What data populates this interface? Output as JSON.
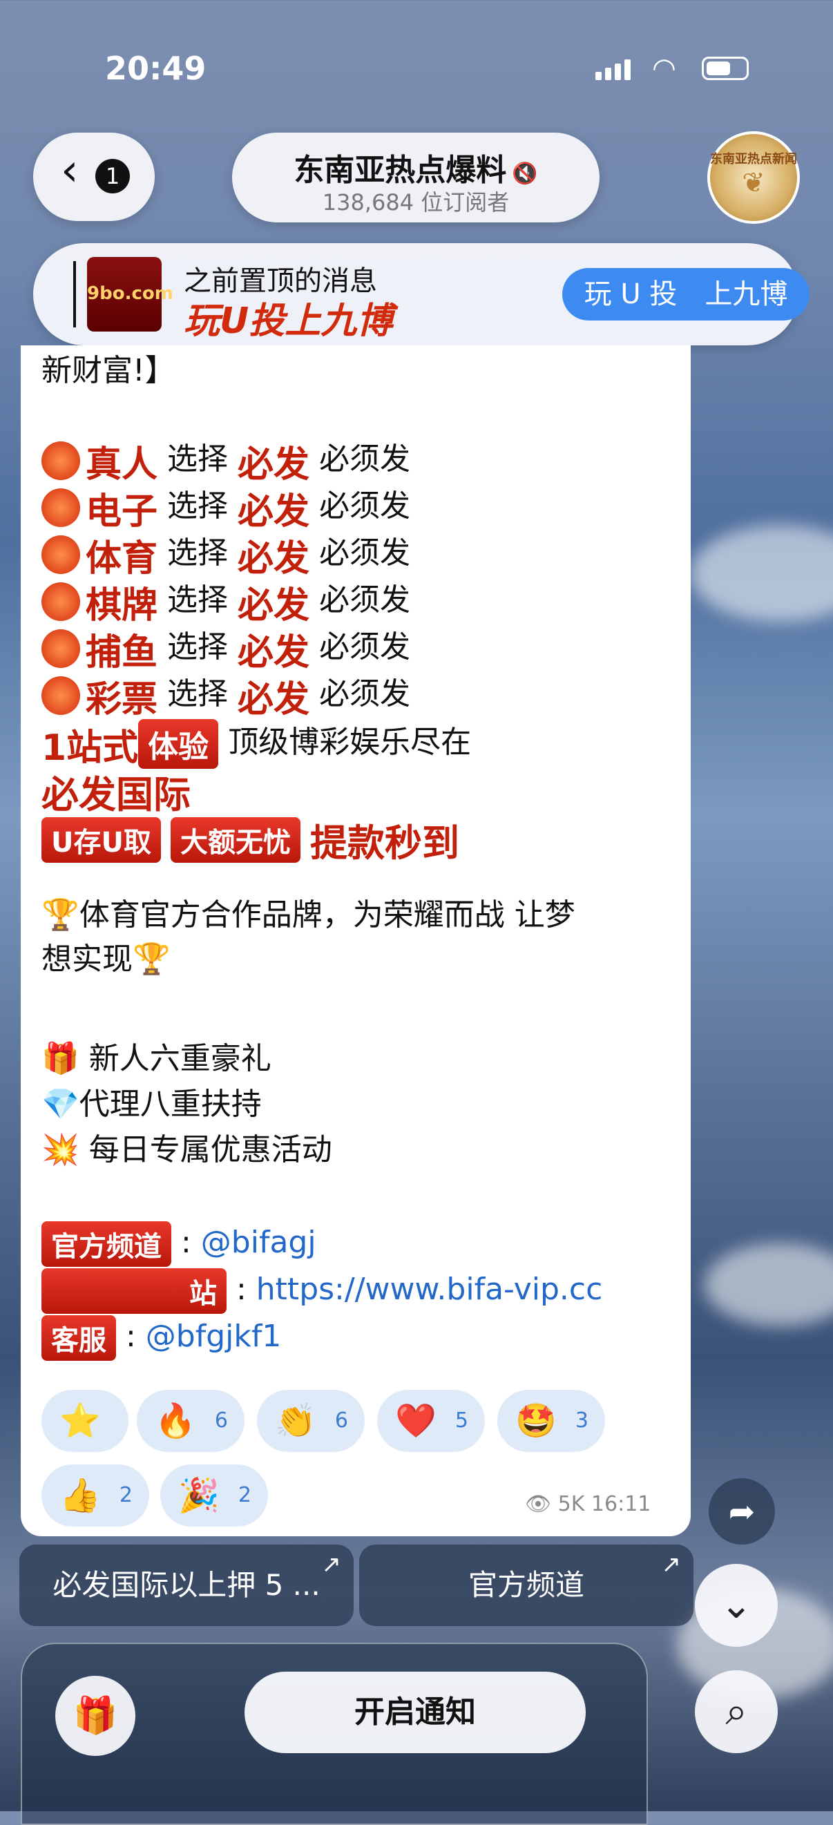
{
  "status": {
    "time": "20:49"
  },
  "header": {
    "back_count": "1",
    "title": "东南亚热点爆料",
    "subscribers": "138,684 位订阅者",
    "avatar_text": "东南亚热点新闻"
  },
  "pinned": {
    "label": "之前置顶的消息",
    "text": "玩U投上九博",
    "thumb_text": "9bo.com",
    "button": "玩 U 投　上九博"
  },
  "message": {
    "lead": "新财富!】",
    "rows": [
      {
        "tag": "真人",
        "text": "选择",
        "brand": "必发",
        "tail": "必须发"
      },
      {
        "tag": "电子",
        "text": "选择",
        "brand": "必发",
        "tail": "必须发"
      },
      {
        "tag": "体育",
        "text": "选择",
        "brand": "必发",
        "tail": "必须发"
      },
      {
        "tag": "棋牌",
        "text": "选择",
        "brand": "必发",
        "tail": "必须发"
      },
      {
        "tag": "捕鱼",
        "text": "选择",
        "brand": "必发",
        "tail": "必须发"
      },
      {
        "tag": "彩票",
        "text": "选择",
        "brand": "必发",
        "tail": "必须发"
      }
    ],
    "onestop_a": "1站式",
    "onestop_b": "体验",
    "onestop_text": "顶级博彩娱乐尽在",
    "brand_big": "必发国际",
    "u_badge": "U存U取",
    "big_badge": "大额无忧",
    "fast": "提款秒到",
    "trophy_line1": "🏆体育官方合作品牌，为荣耀而战  让梦",
    "trophy_line2": "想实现🏆",
    "gift": "🎁 新人六重豪礼",
    "diamond": "💎代理八重扶持",
    "spark": "💥 每日专属优惠活动",
    "official_label": "官方频道",
    "official_value": "@bifagj",
    "site_label": "站",
    "site_value": "https://www.bifa-vip.cc",
    "service_label": "客服",
    "service_value": "@bfgjkf1"
  },
  "reactions": [
    {
      "emoji": "⭐",
      "count": ""
    },
    {
      "emoji": "🔥",
      "count": "6"
    },
    {
      "emoji": "👏",
      "count": "6"
    },
    {
      "emoji": "❤️",
      "count": "5"
    },
    {
      "emoji": "🤩",
      "count": "3"
    },
    {
      "emoji": "👍",
      "count": "2"
    },
    {
      "emoji": "🎉",
      "count": "2"
    }
  ],
  "meta": "👁 5K 16:11",
  "buttons": {
    "left": "必发国际以上押 5 ...",
    "right": "官方频道",
    "notify": "开启通知"
  }
}
